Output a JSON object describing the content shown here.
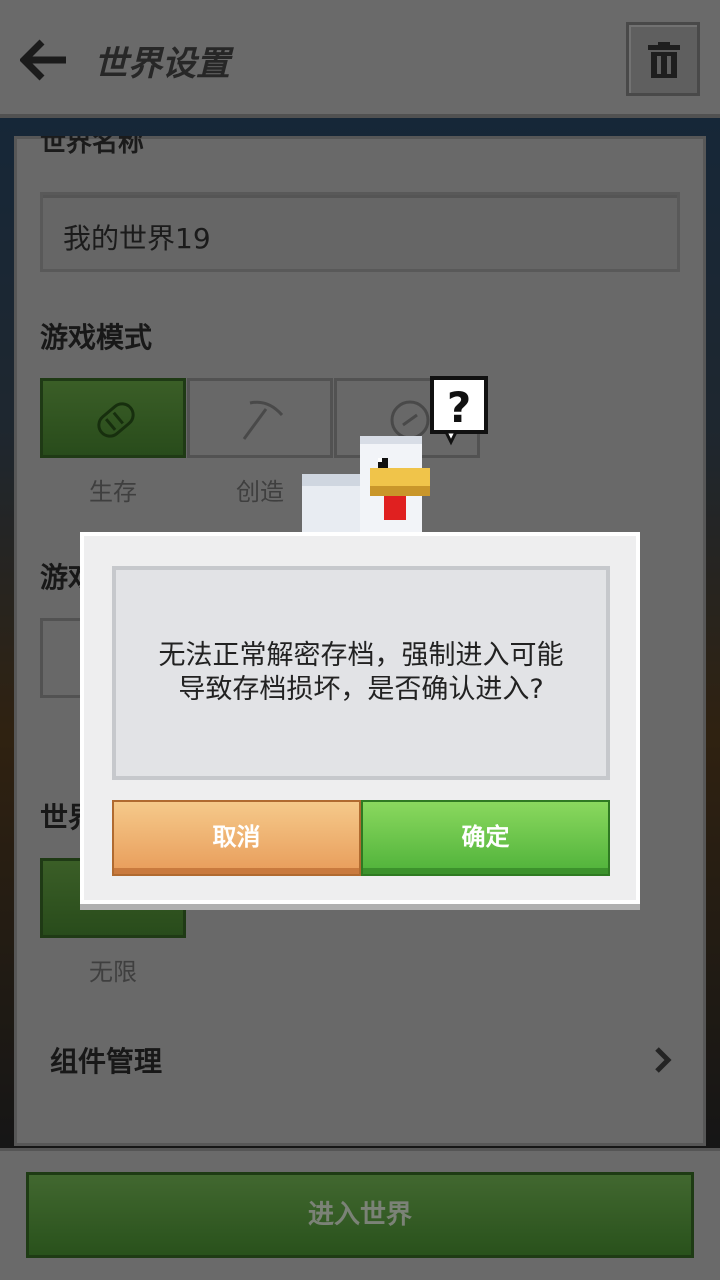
{
  "header": {
    "title": "世界设置"
  },
  "settings": {
    "name_section_label": "世界名称",
    "world_name": "我的世界19",
    "game_mode_label": "游戏模式",
    "modes": [
      {
        "label": "生存",
        "icon": "bread-icon"
      },
      {
        "label": "创造",
        "icon": "pickaxe-icon"
      },
      {
        "label": "",
        "icon": "compass-icon"
      }
    ],
    "difficulty_label": "游戏",
    "world_type_label": "世界",
    "world_type_value": "无限",
    "addons_label": "组件管理"
  },
  "bottom": {
    "enter_label": "进入世界"
  },
  "dialog": {
    "message": "无法正常解密存档，强制进入可能导致存档损坏，是否确认进入?",
    "cancel_label": "取消",
    "confirm_label": "确定"
  },
  "colors": {
    "accent_green": "#4fb23a",
    "cancel_orange": "#e89c5a",
    "dialog_bg": "#eeeeef"
  }
}
